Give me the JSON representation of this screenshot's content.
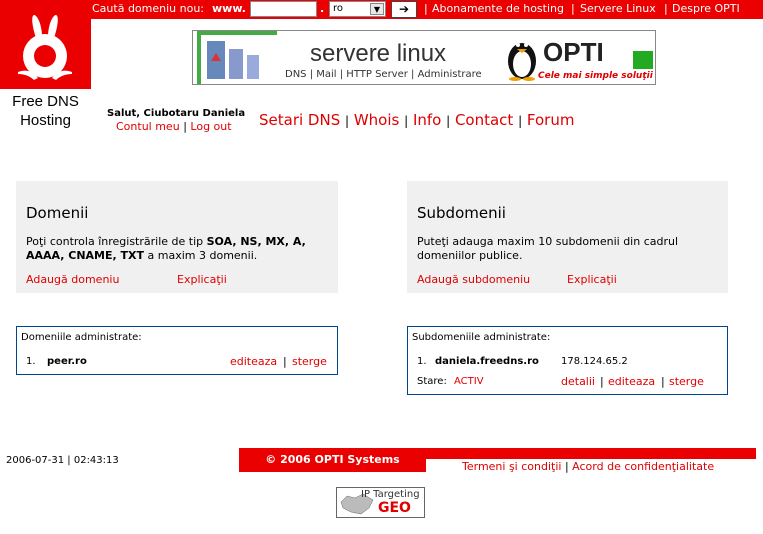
{
  "topbar": {
    "search_label": "Caută domeniu nou:",
    "www": "www.",
    "dot": ".",
    "tld_selected": "ro",
    "go_symbol": "➔",
    "links": [
      "Abonamente de hosting",
      "Servere Linux",
      "Despre OPTI"
    ],
    "sep": "|"
  },
  "logo": {
    "text_line1": "Free DNS",
    "text_line2": "Hosting"
  },
  "banner": {
    "title": "servere linux",
    "subtitle": "DNS | Mail | HTTP Server | Administrare",
    "brand": "OPTI",
    "slogan": "Cele mai simple soluţii"
  },
  "user": {
    "greeting": "Salut, Ciubotaru Daniela",
    "account_link": "Contul meu",
    "logout_link": "Log out"
  },
  "nav": [
    "Setari DNS",
    "Whois",
    "Info",
    "Contact",
    "Forum"
  ],
  "domains_box": {
    "title": "Domenii",
    "desc_line1_pre": "Poţi controla înregistrările de tip ",
    "desc_line1_bold": "SOA, NS, MX, A,",
    "desc_line2_bold": "AAAA, CNAME, TXT",
    "desc_line2_post": " a maxim 3 domenii.",
    "add_link": "Adaugă domeniu",
    "explain_link": "Explicaţii"
  },
  "subdomains_box": {
    "title": "Subdomenii",
    "desc_line1": "Puteţi adauga maxim 10 subdomenii din cadrul",
    "desc_line2": "domeniilor publice.",
    "add_link": "Adaugă subdomeniu",
    "explain_link": "Explicaţii"
  },
  "admin_domains": {
    "caption": "Domeniile administrate:",
    "rows": [
      {
        "num": "1.",
        "name": "peer.ro",
        "edit": "editeaza",
        "delete": "sterge"
      }
    ]
  },
  "admin_subdomains": {
    "caption": "Subdomeniile administrate:",
    "rows": [
      {
        "num": "1.",
        "name": "daniela.freedns.ro",
        "ip": "178.124.65.2",
        "status_label": "Stare:",
        "status": "ACTIV",
        "details": "detalii",
        "edit": "editeaza",
        "delete": "sterge"
      }
    ]
  },
  "footer": {
    "datetime": "2006-07-31 | 02:43:13",
    "copyright": "© 2006 OPTI Systems",
    "terms": "Termeni şi condiţii",
    "privacy": "Acord de confidenţialitate",
    "geo_top": "IP Targeting",
    "geo_bottom": "GEO"
  },
  "colors": {
    "brand_red": "#ea0000",
    "link_red": "#e00000",
    "box_border": "#00468c"
  }
}
